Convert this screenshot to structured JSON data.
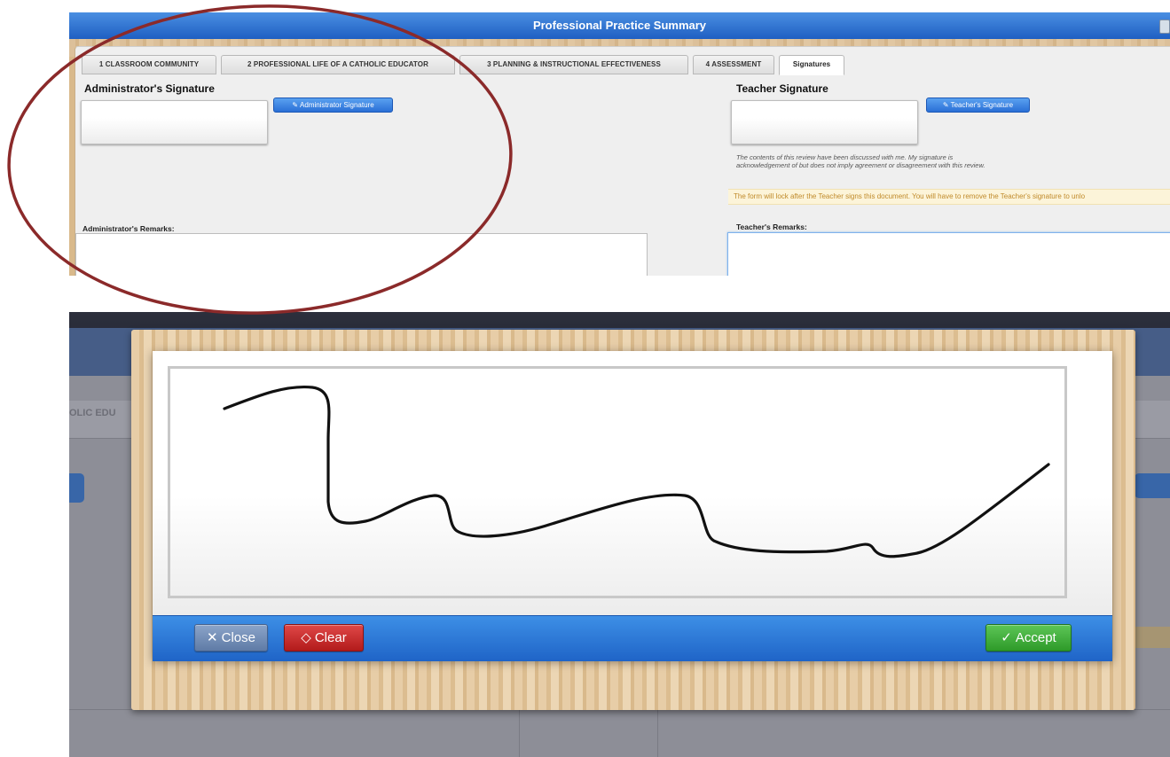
{
  "top": {
    "title": "Professional Practice Summary",
    "tabs": [
      {
        "label": "1 CLASSROOM COMMUNITY"
      },
      {
        "label": "2 PROFESSIONAL LIFE OF A CATHOLIC EDUCATOR"
      },
      {
        "label": "3 PLANNING & INSTRUCTIONAL EFFECTIVENESS"
      },
      {
        "label": "4 ASSESSMENT"
      },
      {
        "label": "Signatures",
        "active": true
      }
    ],
    "admin": {
      "heading": "Administrator's Signature",
      "sign_button": "Administrator Signature",
      "remarks_label": "Administrator's Remarks:"
    },
    "teacher": {
      "heading": "Teacher Signature",
      "sign_button": "Teacher's Signature",
      "disclaimer": "The contents of this review have been discussed with me. My signature is acknowledgement of but does not imply agreement or disagreement with this review.",
      "lock_warning": "The form will lock after the Teacher signs this document. You will have to remove the Teacher's signature to unlo",
      "remarks_label": "Teacher's Remarks:"
    }
  },
  "bottom": {
    "background_tab_text": "OLIC EDU",
    "modal": {
      "close_label": "Close",
      "clear_label": "Clear",
      "accept_label": "Accept"
    }
  },
  "icons": {
    "signature": "signature-icon",
    "close": "x-icon",
    "clear": "eraser-icon",
    "accept": "checkmark-icon"
  },
  "colors": {
    "title_bar": "#2a6fd6",
    "annotation": "#8b2a2a",
    "close_button": "#6d89b4",
    "clear_button": "#c92a2a",
    "accept_button": "#3bab35",
    "warning_text": "#c08a2a"
  }
}
